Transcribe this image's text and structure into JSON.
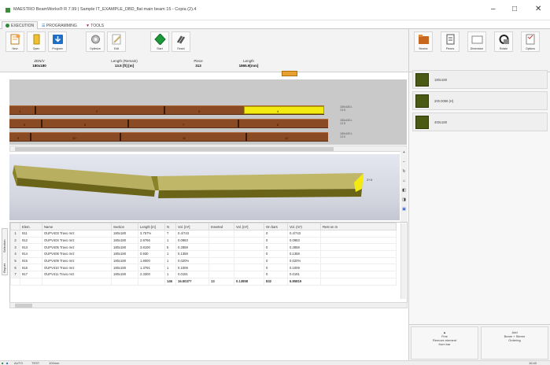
{
  "window": {
    "title": "MAESTRO BeamWorks® R 7.99 | Sample IT_EXAMPLE_DBD_flat main beam 15 - Copia (2).4",
    "minimize": "–",
    "maximize": "□",
    "close": "✕"
  },
  "tabs": [
    {
      "label": "EXECUTION"
    },
    {
      "label": "PROGRAMMING"
    },
    {
      "label": "TOOLS"
    }
  ],
  "ribbon": {
    "buttons": [
      {
        "label": "New",
        "icon": "new-document-icon",
        "color": "#f2a24a"
      },
      {
        "label": "Open",
        "icon": "open-folder-icon",
        "color": "#f0c030"
      },
      {
        "label": "Program",
        "icon": "program-download-icon",
        "color": "#1f6fc6"
      },
      {
        "label": "Optimize",
        "icon": "optimize-gear-icon",
        "color": "#9a9a9a"
      },
      {
        "label": "Edit",
        "icon": "edit-pencil-icon",
        "color": "#c8b070"
      },
      {
        "label": "Start",
        "icon": "start-diamond-icon",
        "color": "#1c9a3a"
      },
      {
        "label": "Reset",
        "icon": "reset-icon",
        "color": "#555555"
      }
    ],
    "info": [
      {
        "label": "ZEN/V",
        "value": "180x180"
      },
      {
        "label": "Length (Remain)",
        "value": "13.5 [ft] [m]"
      },
      {
        "label": "Piece",
        "value": "313"
      },
      {
        "label": "Length",
        "value": "1865.9[mm]"
      }
    ]
  },
  "beams": [
    {
      "label": "180x180 L 13.5",
      "ticks": [
        "1",
        "2",
        "3",
        "4"
      ]
    },
    {
      "label": "180x180 L 13.5",
      "ticks": [
        "5",
        "6",
        "7",
        "8"
      ]
    },
    {
      "label": "180x180 L 13.5",
      "ticks": [
        "9",
        "10",
        "11",
        "12"
      ]
    }
  ],
  "view3d": {
    "axis_label": "Z+X",
    "side_buttons": [
      "+",
      "−",
      "↻",
      "⌂",
      "◧",
      "◨",
      "▣"
    ]
  },
  "side_tabs": [
    "Selection",
    "Report"
  ],
  "grid": {
    "columns": [
      "",
      "Elem.",
      "Name",
      "Section",
      "Length [m]",
      "N",
      "Vol. [m³]",
      "Inserted",
      "Vol. [m³]",
      "On bars",
      "Vol. (m³)",
      "Rest on m"
    ],
    "rows": [
      [
        "1",
        "911",
        "OUPV403 Travo mrz",
        "180x180",
        "3.757%",
        "7",
        "0.4/743",
        "",
        "",
        "0",
        "0.4/743",
        ""
      ],
      [
        "2",
        "912",
        "OUPV404 Travo mrz",
        "180x180",
        "2.9766",
        "1",
        "0.0983",
        "",
        "",
        "0",
        "0.0983",
        ""
      ],
      [
        "3",
        "913",
        "OUPV405 Travo mrz",
        "180x180",
        "3.8100",
        "5",
        "0.2858",
        "",
        "",
        "0",
        "0.2858",
        ""
      ],
      [
        "4",
        "914",
        "OUPV406 Travo mrz",
        "180x180",
        "0.930",
        "1",
        "0.1358",
        "",
        "",
        "0",
        "0.1358",
        ""
      ],
      [
        "5",
        "915",
        "OUPV409 Travo mrz",
        "180x180",
        "1.8000",
        "1",
        "0.020%",
        "",
        "",
        "0",
        "0.020%",
        ""
      ],
      [
        "6",
        "916",
        "OUPV410 Travo mrz",
        "180x180",
        "1.3791",
        "1",
        "0.1009",
        "",
        "",
        "0",
        "0.1009",
        ""
      ],
      [
        "7",
        "917",
        "OUPV411 Travo mrz",
        "180x180",
        "2.3300",
        "1",
        "0.0191",
        "",
        "",
        "0",
        "0.0191",
        ""
      ]
    ],
    "total": [
      "",
      "",
      "",
      "",
      "",
      "146",
      "16.50377",
      "13",
      "0.13858",
      "832",
      "6.85819",
      ""
    ]
  },
  "right_panel": {
    "buttons": [
      {
        "label": "Beams",
        "icon": "beams-icon",
        "color": "#c86820"
      },
      {
        "label": "Pieces",
        "icon": "clipboard-icon",
        "color": "#555555"
      },
      {
        "label": "Dimension",
        "icon": "dimension-icon",
        "color": "#888888"
      },
      {
        "label": "Rotate",
        "icon": "rotate-icon",
        "color": "#222222"
      },
      {
        "label": "Options",
        "icon": "checklist-icon",
        "color": "#c04040"
      }
    ],
    "items": [
      {
        "text": "180x180",
        "color": "#4a5a12"
      },
      {
        "text": "200.0086 (H)",
        "color": "#4a5a12"
      },
      {
        "text": "400x180",
        "color": "#4a5a12"
      }
    ],
    "bottom": [
      {
        "lines": [
          "▲",
          "Fine",
          "Remove element",
          "from bar"
        ]
      },
      {
        "lines": [
          "Add",
          "Beam + Sterne",
          "Ordering"
        ]
      }
    ]
  },
  "status": {
    "items": [
      "AUTO",
      "TEST",
      "100mm"
    ],
    "right": "16:40"
  }
}
